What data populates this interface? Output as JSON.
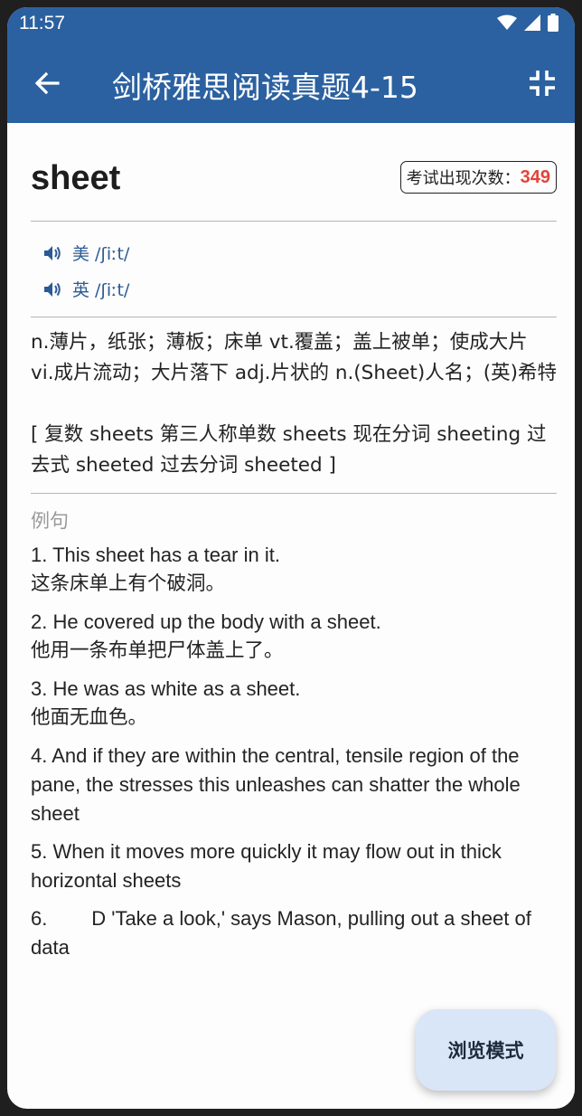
{
  "status": {
    "time": "11:57"
  },
  "appbar": {
    "title": "剑桥雅思阅读真题4-15"
  },
  "word": {
    "headword": "sheet",
    "count_label": "考试出现次数：",
    "count_value": "349"
  },
  "pronunciations": [
    {
      "label": "美 /ʃiːt/"
    },
    {
      "label": "英 /ʃiːt/"
    }
  ],
  "definitions": "n.薄片，纸张；薄板；床单 vt.覆盖；盖上被单；使成大片 vi.成片流动；大片落下 adj.片状的 n.(Sheet)人名；(英)希特",
  "forms": "[ 复数 sheets 第三人称单数 sheets 现在分词 sheeting 过去式 sheeted 过去分词 sheeted ]",
  "examples_label": "例句",
  "examples": [
    {
      "en": "1. This sheet has a tear in it.",
      "zh": "这条床单上有个破洞。"
    },
    {
      "en": "2. He covered up the body with a sheet.",
      "zh": "他用一条布单把尸体盖上了。"
    },
    {
      "en": "3. He was as white as a sheet.",
      "zh": "他面无血色。"
    },
    {
      "en": "4. And if they are within the central, tensile region of the pane, the stresses this unleashes can shatter the whole sheet",
      "zh": ""
    },
    {
      "en": "5. When it moves more quickly it may flow out in thick horizontal sheets",
      "zh": ""
    },
    {
      "en": "6.        D 'Take a look,' says Mason, pulling out a sheet of data",
      "zh": ""
    }
  ],
  "fab": {
    "label": "浏览模式"
  },
  "colors": {
    "appbar": "#2b61a0",
    "accent": "#2b5a96",
    "count": "#e0453a",
    "fab": "#d9e6f8"
  }
}
